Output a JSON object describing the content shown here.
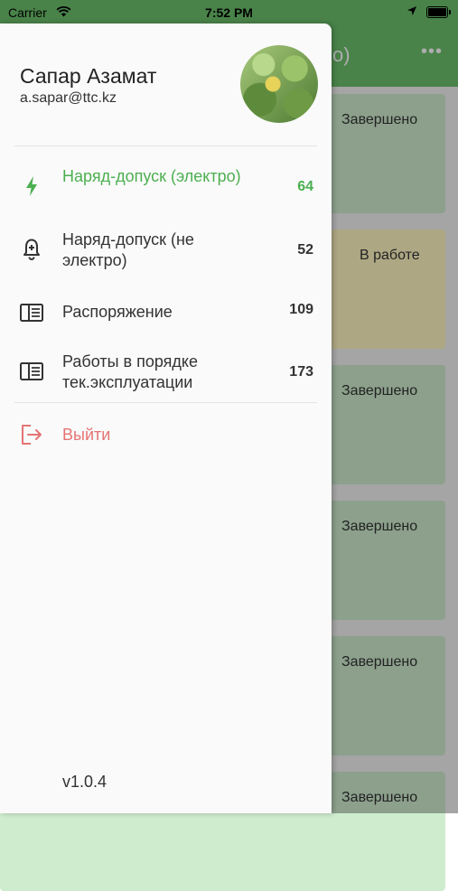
{
  "status_bar": {
    "carrier": "Carrier",
    "time": "7:52 PM"
  },
  "background": {
    "title_fragment": "о)",
    "cards": [
      {
        "status": "Завершено"
      },
      {
        "status": "В работе"
      },
      {
        "status": "Завершено"
      },
      {
        "status": "Завершено"
      },
      {
        "status": "Завершено"
      },
      {
        "status": "Завершено"
      }
    ]
  },
  "drawer": {
    "user": {
      "name": "Сапар Азамат",
      "email": "a.sapar@ttc.kz"
    },
    "menu": [
      {
        "label": "Наряд-допуск (электро)",
        "count": "64",
        "icon": "lightning-icon",
        "active": true
      },
      {
        "label": "Наряд-допуск (не электро)",
        "count": "52",
        "icon": "bell-alert-icon",
        "active": false
      },
      {
        "label": "Распоряжение",
        "count": "109",
        "icon": "book-icon",
        "active": false
      },
      {
        "label": "Работы в порядке тек.эксплуатации",
        "count": "173",
        "icon": "book-icon",
        "active": false
      }
    ],
    "logout_label": "Выйти",
    "version": "v1.0.4"
  },
  "colors": {
    "accent": "#4caf50",
    "logout": "#e57373",
    "header": "#6cc26c"
  }
}
